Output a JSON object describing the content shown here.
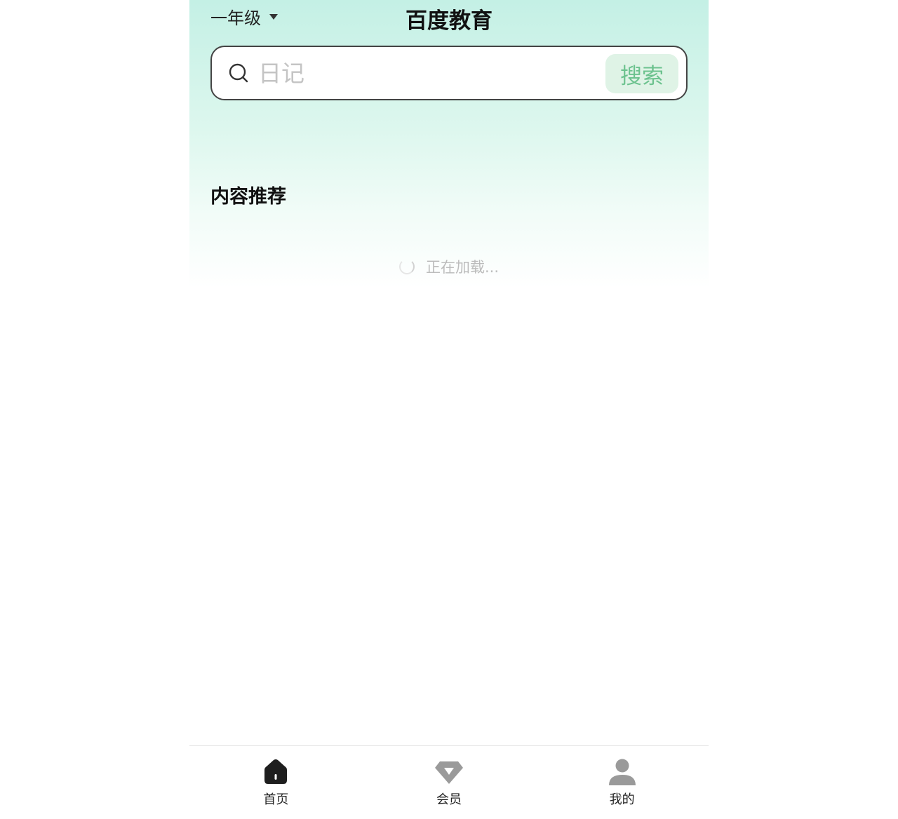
{
  "header": {
    "grade_label": "一年级",
    "title": "百度教育"
  },
  "search": {
    "placeholder": "日记",
    "button_label": "搜索"
  },
  "content": {
    "section_title": "内容推荐",
    "loading_text": "正在加载..."
  },
  "tabbar": {
    "items": [
      {
        "label": "首页",
        "icon": "home-icon",
        "active": true
      },
      {
        "label": "会员",
        "icon": "diamond-icon",
        "active": false
      },
      {
        "label": "我的",
        "icon": "user-icon",
        "active": false
      }
    ]
  },
  "colors": {
    "accent_green": "#6cc28e",
    "search_button_bg": "#dff3e6",
    "hero_gradient_top": "#c4f0e5",
    "active_icon": "#1e1e1e",
    "inactive_icon": "#999999"
  }
}
